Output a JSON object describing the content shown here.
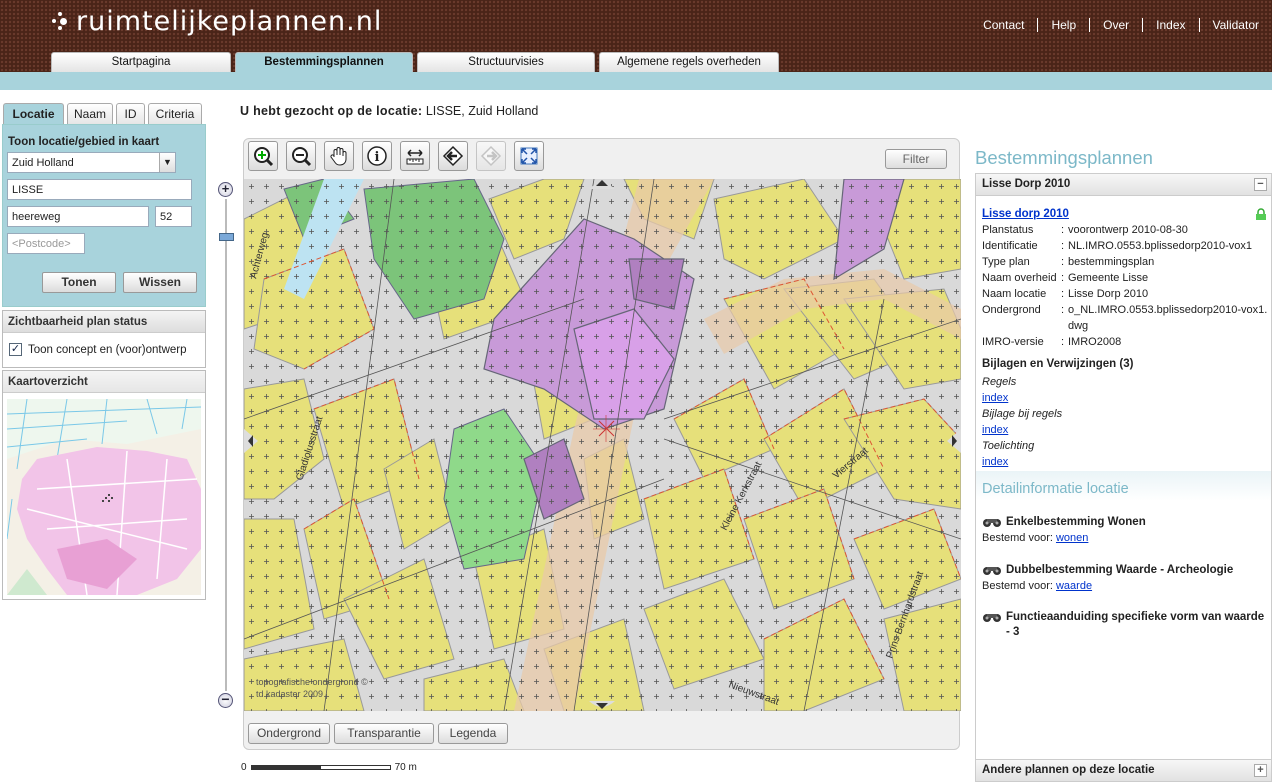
{
  "header": {
    "logo": "ruimtelijkeplannen.nl",
    "links": [
      "Contact",
      "Help",
      "Over",
      "Index",
      "Validator"
    ]
  },
  "tabs": [
    "Startpagina",
    "Bestemmingsplannen",
    "Structuurvisies",
    "Algemene regels overheden"
  ],
  "active_tab": "Bestemmingsplannen",
  "left": {
    "tabs": [
      "Locatie",
      "Naam",
      "ID",
      "Criteria"
    ],
    "title": "Toon locatie/gebied in kaart",
    "province": "Zuid Holland",
    "city": "LISSE",
    "street": "heereweg",
    "number": "52",
    "postcode_placeholder": "<Postcode>",
    "btn_show": "Tonen",
    "btn_clear": "Wissen",
    "status_title": "Zichtbaarheid plan status",
    "status_check": "Toon concept en (voor)ontwerp",
    "overview_title": "Kaartoverzicht"
  },
  "search": {
    "label": "U hebt gezocht op de locatie:",
    "value": "LISSE, Zuid Holland"
  },
  "map": {
    "filter": "Filter",
    "tools": [
      "zoom-in-icon",
      "zoom-out-icon",
      "pan-hand-icon",
      "info-icon",
      "measure-icon",
      "back-icon",
      "forward-icon",
      "fullextent-icon"
    ],
    "copyright1": "topografische ondergrond ©",
    "copyright2": "td kadaster 2009",
    "street_labels": [
      "Gladiolusstraat",
      "Kleine Kerkstraat",
      "Vierstraat",
      "Nieuwstraat",
      "Prins Bernhardstraat",
      "Achterweg"
    ],
    "bottom_buttons": [
      "Ondergrond",
      "Transparantie",
      "Legenda"
    ],
    "scale_start": "0",
    "scale_end": "70 m"
  },
  "right": {
    "title": "Bestemmingsplannen",
    "section": "Lisse Dorp 2010",
    "plan_link": "Lisse dorp 2010",
    "props": [
      {
        "k": "Planstatus",
        "v": "voorontwerp 2010-08-30"
      },
      {
        "k": "Identificatie",
        "v": "NL.IMRO.0553.bplissedorp2010-vox1"
      },
      {
        "k": "Type plan",
        "v": "bestemmingsplan"
      },
      {
        "k": "Naam overheid",
        "v": "Gemeente Lisse"
      },
      {
        "k": "Naam locatie",
        "v": "Lisse Dorp 2010"
      },
      {
        "k": "Ondergrond",
        "v": "o_NL.IMRO.0553.bplissedorp2010-vox1.dwg"
      },
      {
        "k": "IMRO-versie",
        "v": "IMRO2008"
      }
    ],
    "attachments_title": "Bijlagen en Verwijzingen (3)",
    "attachments": [
      {
        "label": "Regels",
        "link": "index"
      },
      {
        "label": "Bijlage bij regels",
        "link": "index"
      },
      {
        "label": "Toelichting",
        "link": "index"
      }
    ],
    "detail_title": "Detailinformatie locatie",
    "details": [
      {
        "title": "Enkelbestemming Wonen",
        "prefix": "Bestemd voor:",
        "link": "wonen"
      },
      {
        "title": "Dubbelbestemming Waarde - Archeologie",
        "prefix": "Bestemd voor:",
        "link": "waarde"
      },
      {
        "title": "Functieaanduiding specifieke vorm van waarde - 3"
      }
    ],
    "other_plans": "Andere plannen op deze locatie"
  },
  "colors": {
    "header": "#4a2418",
    "accent": "#a8d3dc",
    "residential": "#e6e07a",
    "mixed": "#c89ad8",
    "green": "#7cc47a",
    "road": "#d8d8d8"
  }
}
